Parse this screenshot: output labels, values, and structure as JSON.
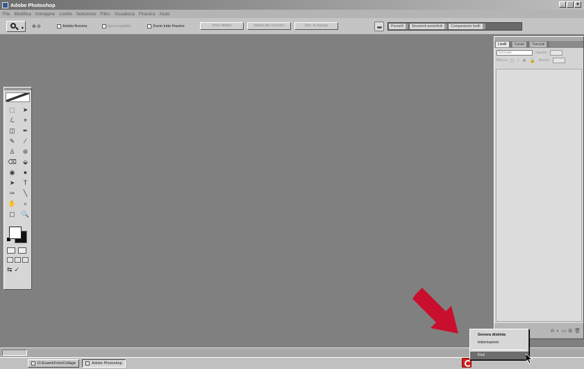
{
  "window": {
    "title": "Adobe Photoshop",
    "controls": [
      "_",
      "□",
      "×"
    ]
  },
  "menubar": {
    "items": [
      "File",
      "Modifica",
      "Immagine",
      "Livello",
      "Selezione",
      "Filtro",
      "Visualizza",
      "Finestra",
      "Aiuto"
    ]
  },
  "options_bar": {
    "zoom_icons": "⊕⊖",
    "checkboxes": [
      {
        "label": "Adatta finestra",
        "enabled": true
      },
      {
        "label": "Ignora palette",
        "enabled": false
      },
      {
        "label": "Zoom tutte finestre",
        "enabled": true
      }
    ],
    "buttons": [
      "Pixel effettivi",
      "Adatta allo schermo",
      "Dim. di stampa"
    ],
    "palette_well_tabs": [
      "Pennelli",
      "Strumenti predefiniti",
      "Composizioni livelli"
    ]
  },
  "toolbox": {
    "tools": [
      "⬚",
      "➤",
      "ℒ",
      "⌖",
      "◫",
      "✒",
      "✎",
      "⁄",
      "♙",
      "⊛",
      "⌫",
      "⬙",
      "◉",
      "●",
      "➤",
      "T",
      "✑",
      "╲",
      "✋",
      "⌕",
      "▢",
      "🔍"
    ],
    "jump_icons": [
      "⇆",
      "✓"
    ]
  },
  "layers_panel": {
    "tabs": [
      "Livelli",
      "Canali",
      "Tracciati"
    ],
    "blend_mode": "Normale",
    "opacity_label": "Opacità:",
    "lock_label": "Blocca:",
    "fill_label": "Riemp.:",
    "lock_icons": "▢ ⁄ ✥ 🔒",
    "footer_icons": [
      "⊘",
      "◐",
      "▭",
      "⊞",
      "🗑"
    ]
  },
  "context_menu": {
    "items": [
      {
        "label": "Genera distinta",
        "bold": true
      },
      {
        "label": "Informazioni",
        "bold": false
      },
      {
        "label": "Esci",
        "bold": false,
        "highlighted": true
      }
    ]
  },
  "taskbar": {
    "items": [
      {
        "label": "D:\\Esami\\Foto\\Collage",
        "active": false
      },
      {
        "label": "Adobe Photoshop",
        "active": true
      }
    ]
  },
  "colors": {
    "workspace": "#808080",
    "arrow": "#c8102e",
    "tray_icon": "#d21e1e"
  }
}
